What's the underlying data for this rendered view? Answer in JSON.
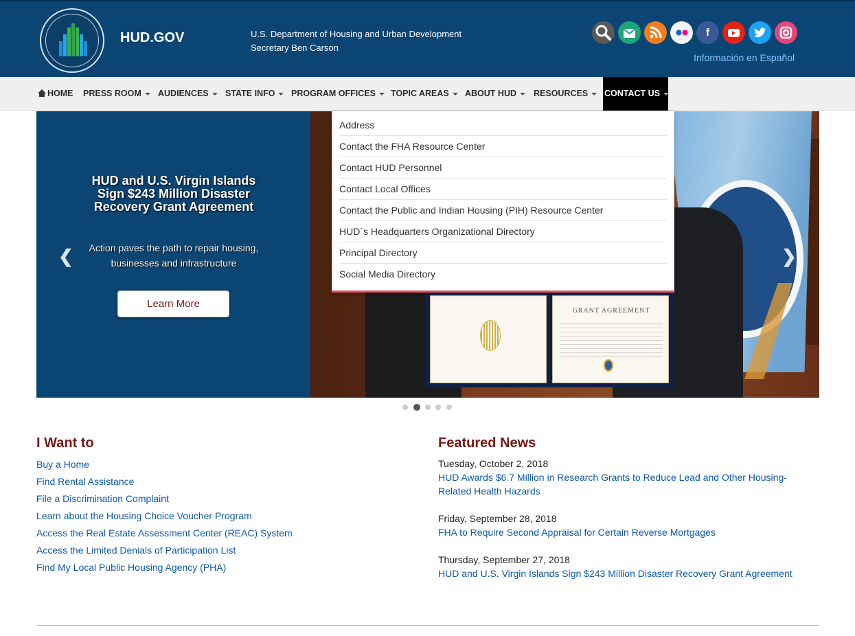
{
  "header": {
    "site_title": "HUD.GOV",
    "agency_line1": "U.S. Department of Housing and Urban Development",
    "agency_line2": "Secretary Ben Carson",
    "espanol": "Información en Español",
    "seal_text": "U.S. DEPARTMENT OF HOUSING AND URBAN DEVELOPMENT",
    "social": [
      "search-icon",
      "email-icon",
      "rss-icon",
      "flickr-icon",
      "facebook-icon",
      "youtube-icon",
      "twitter-icon",
      "instagram-icon"
    ]
  },
  "nav": {
    "items": [
      {
        "label": "HOME"
      },
      {
        "label": "PRESS ROOM"
      },
      {
        "label": "AUDIENCES"
      },
      {
        "label": "STATE INFO"
      },
      {
        "label": "PROGRAM OFFICES"
      },
      {
        "label": "TOPIC AREAS"
      },
      {
        "label": "ABOUT HUD"
      },
      {
        "label": "RESOURCES"
      },
      {
        "label": "CONTACT US"
      }
    ],
    "active": "CONTACT US"
  },
  "dropdown": {
    "items": [
      "Address",
      "Contact the FHA Resource Center",
      "Contact HUD Personnel",
      "Contact Local Offices",
      "Contact the Public and Indian Housing (PIH) Resource Center",
      "HUD´s Headquarters Organizational Directory",
      "Principal Directory",
      "Social Media Directory"
    ]
  },
  "hero": {
    "title": "HUD and U.S. Virgin Islands Sign $243 Million Disaster Recovery Grant Agreement",
    "subtitle": "Action paves the path to repair housing, businesses and infrastructure",
    "button": "Learn More",
    "certificate_title": "GRANT AGREEMENT",
    "slide_count": 5,
    "active_slide": 2
  },
  "i_want_to": {
    "title": "I Want to",
    "links": [
      "Buy a Home",
      "Find Rental Assistance",
      "File a Discrimination Complaint",
      "Learn about the Housing Choice Voucher Program",
      "Access the Real Estate Assessment Center (REAC) System",
      "Access the Limited Denials of Participation List",
      "Find My Local Public Housing Agency (PHA)"
    ]
  },
  "featured_news": {
    "title": "Featured News",
    "items": [
      {
        "date": "Tuesday, October 2, 2018",
        "headline": "HUD Awards $6.7 Million in Research Grants to Reduce Lead and Other Housing-Related Health Hazards"
      },
      {
        "date": "Friday, September 28, 2018",
        "headline": "FHA to Require Second Appraisal for Certain Reverse Mortgages"
      },
      {
        "date": "Thursday, September 27, 2018",
        "headline": "HUD and U.S. Virgin Islands Sign $243 Million Disaster Recovery Grant Agreement"
      }
    ]
  },
  "colors": {
    "header_bg": "#0a4574",
    "title_red": "#7a1713",
    "link_blue": "#0a58a8",
    "dropdown_accent": "#e3505a"
  }
}
